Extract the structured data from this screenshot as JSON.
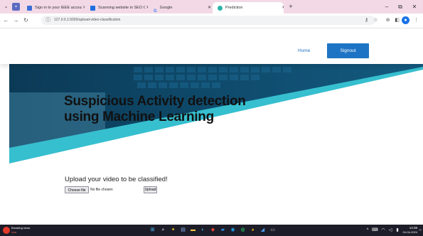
{
  "browser": {
    "tabs": [
      {
        "label": "Sign in to your IEEE account",
        "active": false
      },
      {
        "label": "Scanning website in SEO CORNER",
        "active": false
      },
      {
        "label": "Google",
        "active": false
      },
      {
        "label": "Prediction",
        "active": true
      }
    ],
    "url": "127.0.0.1:5000/upload-video-classification"
  },
  "page": {
    "nav": {
      "home": "Home",
      "signout": "Signout"
    },
    "hero_title": "Suspicious Activity detection using Machine Learning",
    "upload": {
      "label": "Upload your video to be classified!",
      "choose_button": "Choose file",
      "no_file_text": "No file chosen",
      "upload_button": "Upload"
    }
  },
  "taskbar": {
    "weather_title": "Breaking news",
    "weather_sub": "Live",
    "clock_time": "14:38",
    "clock_date": "04-04-2024"
  },
  "colors": {
    "tab_strip": "#f3d9e6",
    "accent_blue": "#1e74c4",
    "teal": "#36bfcf",
    "hero_dark": "#0d3f5b",
    "taskbar": "#1d1d29"
  }
}
